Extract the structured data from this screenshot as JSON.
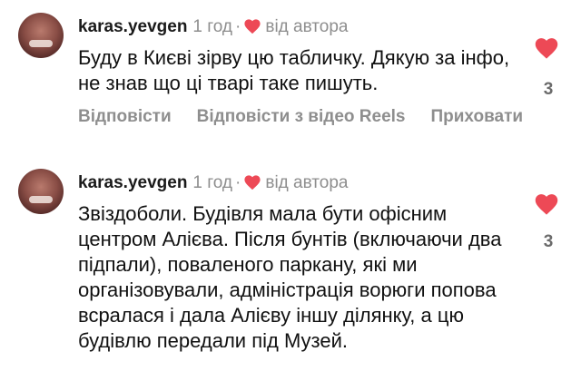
{
  "colors": {
    "like_red": "#ed4956",
    "meta_gray": "#8e8e8e"
  },
  "comments": [
    {
      "username": "karas.yevgen",
      "time": "1 год",
      "separator": "·",
      "by_author_icon": "heart-icon",
      "by_author": "від автора",
      "text": "Буду в Києві зірву цю табличку. Дякую за інфо, не знав що ці тварі таке пишуть.",
      "like_icon": "heart-icon",
      "likes": "3",
      "actions": {
        "reply": "Відповісти",
        "reply_reels": "Відповісти з відео Reels",
        "hide": "Приховати"
      }
    },
    {
      "username": "karas.yevgen",
      "time": "1 год",
      "separator": "·",
      "by_author_icon": "heart-icon",
      "by_author": "від автора",
      "text": "Звіздоболи. Будівля мала бути офісним центром Алієва. Після бунтів (включаючи два підпали), поваленого паркану, які ми організовували, адміністрація ворюги попова всралася і дала Алієву іншу ділянку, а цю будівлю передали під Музей.",
      "like_icon": "heart-icon",
      "likes": "3"
    }
  ]
}
